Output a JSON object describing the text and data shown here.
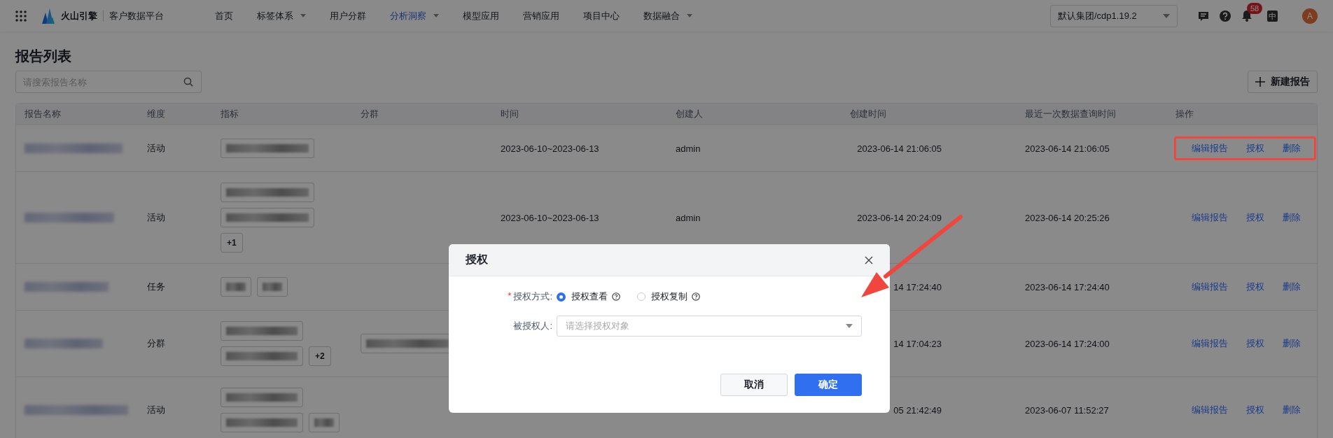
{
  "header": {
    "brand": "火山引擎",
    "product": "客户数据平台",
    "nav": [
      {
        "label": "首页",
        "selected": false,
        "dropdown": false
      },
      {
        "label": "标签体系",
        "selected": false,
        "dropdown": true
      },
      {
        "label": "用户分群",
        "selected": false,
        "dropdown": false
      },
      {
        "label": "分析洞察",
        "selected": true,
        "dropdown": true
      },
      {
        "label": "模型应用",
        "selected": false,
        "dropdown": false
      },
      {
        "label": "营销应用",
        "selected": false,
        "dropdown": false
      },
      {
        "label": "项目中心",
        "selected": false,
        "dropdown": false
      },
      {
        "label": "数据融合",
        "selected": false,
        "dropdown": true
      }
    ],
    "project_select": "默认集团/cdp1.19.2",
    "notification_count": "58",
    "language": "中",
    "avatar": "A"
  },
  "page": {
    "title": "报告列表",
    "search": {
      "placeholder": "请搜索报告名称"
    },
    "new_button": "新建报告"
  },
  "table": {
    "columns": [
      "报告名称",
      "维度",
      "指标",
      "分群",
      "时间",
      "创建人",
      "创建时间",
      "最近一次数据查询时间",
      "操作"
    ],
    "rows": [
      {
        "dimension": "活动",
        "metrics": [
          {
            "kind": "wide"
          }
        ],
        "metrics_more": "",
        "segments": [],
        "time": "2023-06-10~2023-06-13",
        "creator": "admin",
        "created": "2023-06-14 21:06:05",
        "last_query": "2023-06-14 21:06:05",
        "actions": [
          "编辑报告",
          "授权",
          "删除"
        ],
        "highlighted": true
      },
      {
        "dimension": "活动",
        "metrics": [
          {
            "kind": "wide"
          },
          {
            "kind": "wide"
          }
        ],
        "metrics_more": "+1",
        "segments": [],
        "time": "2023-06-10~2023-06-13",
        "creator": "admin",
        "created": "2023-06-14 20:24:09",
        "last_query": "2023-06-14 20:25:26",
        "actions": [
          "编辑报告",
          "授权",
          "删除"
        ],
        "highlighted": false
      },
      {
        "dimension": "任务",
        "metrics": [
          {
            "kind": "narrow"
          },
          {
            "kind": "narrow"
          }
        ],
        "metrics_more": "",
        "segments": [],
        "created": "14 17:24:40",
        "last_query": "2023-06-14 17:24:40",
        "actions": [
          "编辑报告",
          "授权",
          "删除"
        ],
        "highlighted": false
      },
      {
        "dimension": "分群",
        "metrics": [
          {
            "kind": "medium"
          },
          {
            "kind": "medium"
          }
        ],
        "metrics_more": "+2",
        "segments": [
          {
            "kind": "wide"
          }
        ],
        "created": "14 17:04:23",
        "last_query": "2023-06-14 17:24:00",
        "actions": [
          "编辑报告",
          "授权",
          "删除"
        ],
        "highlighted": false
      },
      {
        "dimension": "活动",
        "metrics": [
          {
            "kind": "medium"
          },
          {
            "kind": "medium"
          },
          {
            "kind": "narrow"
          }
        ],
        "metrics_more": "",
        "segments": [],
        "created": "05 21:42:49",
        "last_query": "2023-06-07 11:52:27",
        "actions": [
          "编辑报告",
          "授权",
          "删除"
        ],
        "highlighted": false
      }
    ]
  },
  "dialog": {
    "title": "授权",
    "fields": [
      {
        "kind": "radio",
        "label": "授权方式:",
        "required_mark": "*",
        "options": [
          {
            "label": "授权查看",
            "selected": true
          },
          {
            "label": "授权复制",
            "selected": false
          }
        ]
      },
      {
        "kind": "select",
        "label": "被授权人:",
        "placeholder": "请选择授权对象"
      }
    ],
    "buttons": [
      {
        "label": "取消",
        "kind": "secondary"
      },
      {
        "label": "确定",
        "kind": "primary"
      }
    ]
  },
  "annotation": {
    "arrow": true
  }
}
